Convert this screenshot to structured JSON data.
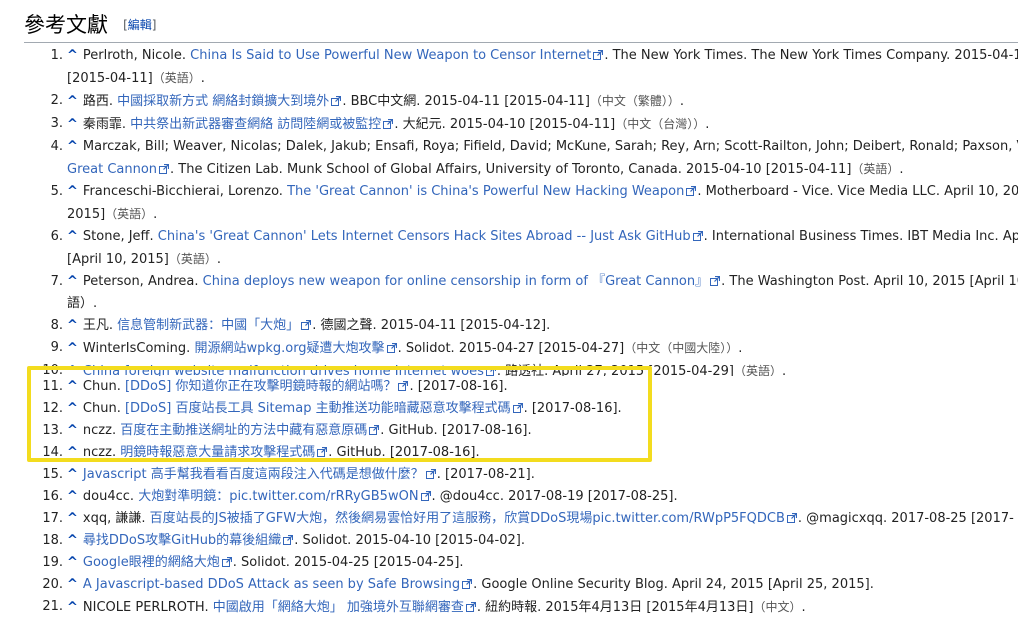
{
  "section": {
    "title": "參考文獻",
    "edit_open": "[",
    "edit_label": "編輯",
    "edit_close": "]"
  },
  "refs": [
    {
      "num": "1.",
      "lines": [
        [
          {
            "t": "Perlroth, Nicole. "
          },
          {
            "t": "China Is Said to Use Powerful New Weapon to Censor Internet",
            "l": 1
          },
          {
            "t": ". The New York Times. The New York Times Company. 2015-04-10"
          }
        ],
        [
          {
            "t": "[2015-04-11]"
          },
          {
            "t": "（英語）",
            "g": 1
          },
          {
            "t": "."
          }
        ]
      ]
    },
    {
      "num": "2.",
      "lines": [
        [
          {
            "t": "路西. "
          },
          {
            "t": "中國採取新方式 網絡封鎖擴大到境外",
            "l": 1
          },
          {
            "t": ". BBC中文網. 2015-04-11 [2015-04-11]"
          },
          {
            "t": "（中文（繁體））",
            "g": 1
          },
          {
            "t": "."
          }
        ]
      ]
    },
    {
      "num": "3.",
      "lines": [
        [
          {
            "t": "秦雨霏. "
          },
          {
            "t": "中共祭出新武器審查網絡 訪問陸網或被監控",
            "l": 1
          },
          {
            "t": ". 大紀元. 2015-04-10 [2015-04-11]"
          },
          {
            "t": "（中文（台灣））",
            "g": 1
          },
          {
            "t": "."
          }
        ]
      ]
    },
    {
      "num": "4.",
      "lines": [
        [
          {
            "t": "Marczak, Bill; Weaver, Nicolas; Dalek, Jakub; Ensafi, Roya; Fifield, David; McKune, Sarah; Rey, Arn; Scott-Railton, John; Deibert, Ronald; Paxson, Vern"
          }
        ],
        [
          {
            "t": "Great Cannon",
            "l": 1
          },
          {
            "t": ". The Citizen Lab. Munk School of Global Affairs, University of Toronto, Canada. 2015-04-10 [2015-04-11]"
          },
          {
            "t": "（英語）",
            "g": 1
          },
          {
            "t": "."
          }
        ]
      ]
    },
    {
      "num": "5.",
      "lines": [
        [
          {
            "t": "Franceschi-Bicchierai, Lorenzo. "
          },
          {
            "t": "The 'Great Cannon' is China's Powerful New Hacking Weapon",
            "l": 1
          },
          {
            "t": ". Motherboard - Vice. Vice Media LLC. April 10, 2015"
          }
        ],
        [
          {
            "t": "2015]"
          },
          {
            "t": "（英語）",
            "g": 1
          },
          {
            "t": "."
          }
        ]
      ]
    },
    {
      "num": "6.",
      "lines": [
        [
          {
            "t": "Stone, Jeff. "
          },
          {
            "t": "China's 'Great Cannon' Lets Internet Censors Hack Sites Abroad -- Just Ask GitHub",
            "l": 1
          },
          {
            "t": ". International Business Times. IBT Media Inc. April"
          }
        ],
        [
          {
            "t": "[April 10, 2015]"
          },
          {
            "t": "（英語）",
            "g": 1
          },
          {
            "t": "."
          }
        ]
      ]
    },
    {
      "num": "7.",
      "lines": [
        [
          {
            "t": "Peterson, Andrea. "
          },
          {
            "t": "China deploys new weapon for online censorship in form of 『Great Cannon』",
            "l": 1
          },
          {
            "t": ". The Washington Post. April 10, 2015 [April 10, 2015"
          }
        ],
        [
          {
            "t": "語）."
          }
        ]
      ]
    },
    {
      "num": "8.",
      "lines": [
        [
          {
            "t": "王凡. "
          },
          {
            "t": "信息管制新武器：中國「大炮」",
            "l": 1
          },
          {
            "t": ". 德國之聲. 2015-04-11 [2015-04-12]."
          }
        ]
      ]
    },
    {
      "num": "9.",
      "lines": [
        [
          {
            "t": "WinterIsComing. "
          },
          {
            "t": "開源網站wpkg.org疑遭大炮攻擊",
            "l": 1
          },
          {
            "t": ". Solidot. 2015-04-27 [2015-04-27]"
          },
          {
            "t": "（中文（中國大陸））",
            "g": 1
          },
          {
            "t": "."
          }
        ]
      ]
    },
    {
      "num": "10.",
      "clip": 1,
      "lines": [
        [
          {
            "t": "China foreign website malfunction drives home Internet woes",
            "l": 1
          },
          {
            "t": ". 路透社. April 27, 2015 [2015-04-29]"
          },
          {
            "t": "（英語）",
            "g": 1
          },
          {
            "t": "."
          }
        ]
      ]
    },
    {
      "num": "11.",
      "lines": [
        [
          {
            "t": "Chun. "
          },
          {
            "t": "[DDoS] 你知道你正在攻擊明鏡時報的網站嗎？",
            "l": 1
          },
          {
            "t": ". [2017-08-16]."
          }
        ]
      ]
    },
    {
      "num": "12.",
      "lines": [
        [
          {
            "t": "Chun. "
          },
          {
            "t": "[DDoS] 百度站長工具 Sitemap 主動推送功能暗藏惡意攻擊程式碼",
            "l": 1
          },
          {
            "t": ". [2017-08-16]."
          }
        ]
      ]
    },
    {
      "num": "13.",
      "lines": [
        [
          {
            "t": "nczz. "
          },
          {
            "t": "百度在主動推送網址的方法中藏有惡意原碼",
            "l": 1
          },
          {
            "t": ". GitHub. [2017-08-16]."
          }
        ]
      ]
    },
    {
      "num": "14.",
      "lines": [
        [
          {
            "t": "nczz. "
          },
          {
            "t": "明鏡時報惡意大量請求攻擊程式碼",
            "l": 1
          },
          {
            "t": ". GitHub. [2017-08-16]."
          }
        ]
      ]
    },
    {
      "num": "15.",
      "lines": [
        [
          {
            "t": "Javascript 高手幫我看看百度這兩段注入代碼是想做什麼？",
            "l": 1
          },
          {
            "t": ". [2017-08-21]."
          }
        ]
      ]
    },
    {
      "num": "16.",
      "lines": [
        [
          {
            "t": "dou4cc. "
          },
          {
            "t": "大炮對準明鏡：pic.twitter.com/rRRyGB5wON",
            "l": 1
          },
          {
            "t": ". @dou4cc. 2017-08-19 [2017-08-25]."
          }
        ]
      ]
    },
    {
      "num": "17.",
      "lines": [
        [
          {
            "t": "xqq, 謙謙. "
          },
          {
            "t": "百度站長的JS被插了GFW大炮，然後網易雲恰好用了這服務，欣賞DDoS現場pic.twitter.com/RWpP5FQDCB",
            "l": 1
          },
          {
            "t": ". @magicxqq. 2017-08-25 [2017-"
          }
        ]
      ]
    },
    {
      "num": "18.",
      "lines": [
        [
          {
            "t": "尋找DDoS攻擊GitHub的幕後組織",
            "l": 1
          },
          {
            "t": ". Solidot. 2015-04-10 [2015-04-02]."
          }
        ]
      ]
    },
    {
      "num": "19.",
      "lines": [
        [
          {
            "t": "Google眼裡的網絡大炮",
            "l": 1
          },
          {
            "t": ". Solidot. 2015-04-25 [2015-04-25]."
          }
        ]
      ]
    },
    {
      "num": "20.",
      "lines": [
        [
          {
            "t": "A Javascript-based DDoS Attack as seen by Safe Browsing",
            "l": 1
          },
          {
            "t": ". Google Online Security Blog. April 24, 2015 [April 25, 2015]."
          }
        ]
      ]
    },
    {
      "num": "21.",
      "lines": [
        [
          {
            "t": "NICOLE PERLROTH. "
          },
          {
            "t": "中國啟用「網絡大炮」 加強境外互聯網審查",
            "l": 1
          },
          {
            "t": ". 紐約時報. 2015年4月13日 [2015年4月13日]"
          },
          {
            "t": "（中文）",
            "g": 1
          },
          {
            "t": "."
          }
        ]
      ]
    }
  ],
  "caret_symbol": "^",
  "colors": {
    "link": "#3366bb",
    "highlight": "#f3dc1e",
    "rule": "#a2a9b1"
  }
}
